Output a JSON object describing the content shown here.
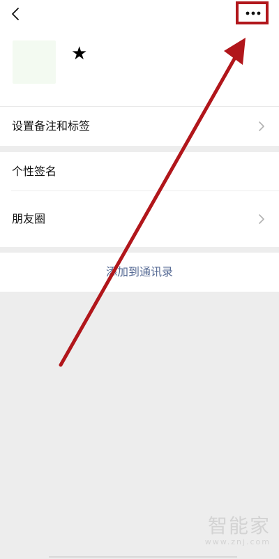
{
  "header": {
    "back_icon": "chevron-left-icon",
    "more_icon": "more-dots-icon",
    "highlight_color": "#b1161b"
  },
  "profile": {
    "star_icon": "star-icon",
    "star_glyph": "★"
  },
  "rows": {
    "remark_tags": "设置备注和标签",
    "signature": "个性签名",
    "moments": "朋友圈"
  },
  "actions": {
    "add_contact": "添加到通讯录"
  },
  "watermark": {
    "brand": "智能家",
    "url": "www.znj.com"
  },
  "colors": {
    "link": "#576b95",
    "background": "#ededed",
    "arrow": "#b1161b"
  }
}
